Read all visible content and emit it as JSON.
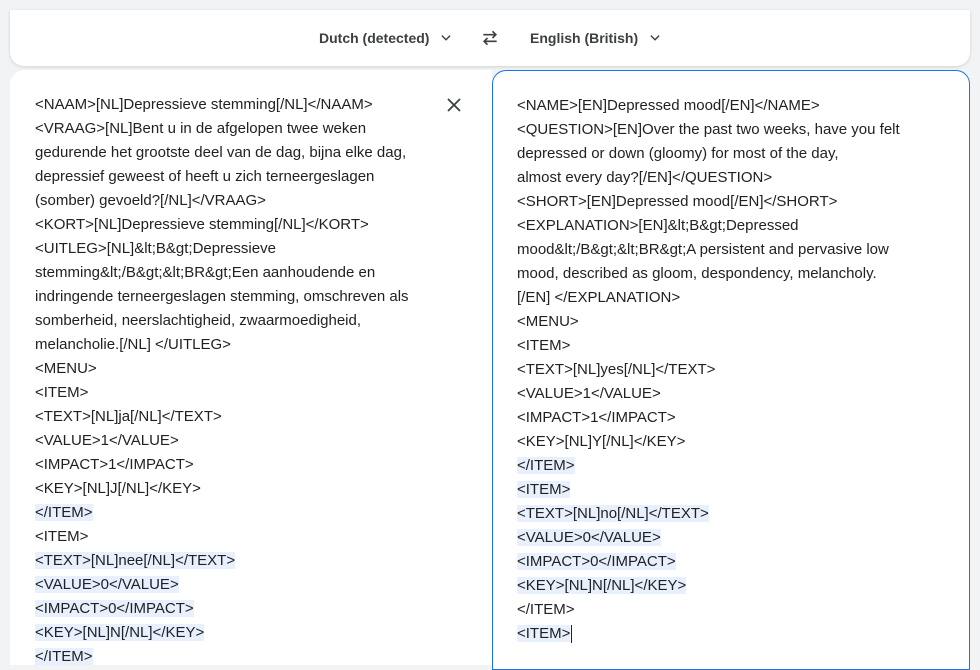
{
  "language_bar": {
    "source_language": "Dutch (detected)",
    "target_language": "English (British)"
  },
  "icons": {
    "chevron": "chevron-down-icon",
    "swap": "swap-languages-icon",
    "clear": "close-icon"
  },
  "colors": {
    "accent": "#1a73e8",
    "highlight": "#e8f0fe",
    "text": "#202124"
  },
  "source_panel": {
    "lines": [
      {
        "text": "<NAAM>[NL]Depressieve stemming[/NL]</NAAM>",
        "hl": false
      },
      {
        "text": "<VRAAG>[NL]Bent u in de afgelopen twee weken",
        "hl": false
      },
      {
        "text": "gedurende het grootste deel van de dag, bijna elke dag,",
        "hl": false
      },
      {
        "text": "depressief geweest of heeft u zich terneergeslagen",
        "hl": false
      },
      {
        "text": "(somber) gevoeld?[/NL]</VRAAG>",
        "hl": false
      },
      {
        "text": "<KORT>[NL]Depressieve stemming[/NL]</KORT>",
        "hl": false
      },
      {
        "text": "<UITLEG>[NL]&lt;B&gt;Depressieve",
        "hl": false
      },
      {
        "text": "stemming&lt;/B&gt;&lt;BR&gt;Een aanhoudende en",
        "hl": false
      },
      {
        "text": "indringende terneergeslagen stemming, omschreven als",
        "hl": false
      },
      {
        "text": "somberheid, neerslachtigheid, zwaarmoedigheid,",
        "hl": false
      },
      {
        "text": "melancholie.[/NL] </UITLEG>",
        "hl": false
      },
      {
        "text": "<MENU>",
        "hl": false
      },
      {
        "text": "<ITEM>",
        "hl": false
      },
      {
        "text": "<TEXT>[NL]ja[/NL]</TEXT>",
        "hl": false
      },
      {
        "text": "<VALUE>1</VALUE>",
        "hl": false
      },
      {
        "text": "<IMPACT>1</IMPACT>",
        "hl": false
      },
      {
        "text": "<KEY>[NL]J[/NL]</KEY>",
        "hl": false
      },
      {
        "text": "</ITEM>",
        "hl": true
      },
      {
        "text": "<ITEM>",
        "hl": false
      },
      {
        "text": "<TEXT>[NL]nee[/NL]</TEXT>",
        "hl": true
      },
      {
        "text": "<VALUE>0</VALUE>",
        "hl": true
      },
      {
        "text": "<IMPACT>0</IMPACT>",
        "hl": true
      },
      {
        "text": "<KEY>[NL]N[/NL]</KEY>",
        "hl": true
      },
      {
        "text": "</ITEM>",
        "hl": true
      }
    ]
  },
  "target_panel": {
    "lines": [
      {
        "text": "<NAME>[EN]Depressed mood[/EN]</NAME>",
        "hl": false
      },
      {
        "text": "<QUESTION>[EN]Over the past two weeks, have you felt",
        "hl": false
      },
      {
        "text": "depressed or down (gloomy) for most of the day,",
        "hl": false
      },
      {
        "text": "almost every day?[/EN]</QUESTION>",
        "hl": false
      },
      {
        "text": "<SHORT>[EN]Depressed mood[/EN]</SHORT>",
        "hl": false
      },
      {
        "text": "<EXPLANATION>[EN]&lt;B&gt;Depressed",
        "hl": false
      },
      {
        "text": "mood&lt;/B&gt;&lt;BR&gt;A persistent and pervasive low",
        "hl": false
      },
      {
        "text": "mood, described as gloom, despondency, melancholy.",
        "hl": false
      },
      {
        "text": "[/EN] </EXPLANATION>",
        "hl": false
      },
      {
        "text": "<MENU>",
        "hl": false
      },
      {
        "text": "<ITEM>",
        "hl": false
      },
      {
        "text": "<TEXT>[NL]yes[/NL]</TEXT>",
        "hl": false
      },
      {
        "text": "<VALUE>1</VALUE>",
        "hl": false
      },
      {
        "text": "<IMPACT>1</IMPACT>",
        "hl": false
      },
      {
        "text": "<KEY>[NL]Y[/NL]</KEY>",
        "hl": false
      },
      {
        "text": "</ITEM>",
        "hl": true
      },
      {
        "text": "<ITEM>",
        "hl": true
      },
      {
        "text": "<TEXT>[NL]no[/NL]</TEXT>",
        "hl": true
      },
      {
        "text": "<VALUE>0</VALUE>",
        "hl": true
      },
      {
        "text": "<IMPACT>0</IMPACT>",
        "hl": true
      },
      {
        "text": "<KEY>[NL]N[/NL]</KEY>",
        "hl": true
      },
      {
        "text": "</ITEM>",
        "hl": false
      },
      {
        "text": "<ITEM>",
        "hl": true
      }
    ]
  }
}
